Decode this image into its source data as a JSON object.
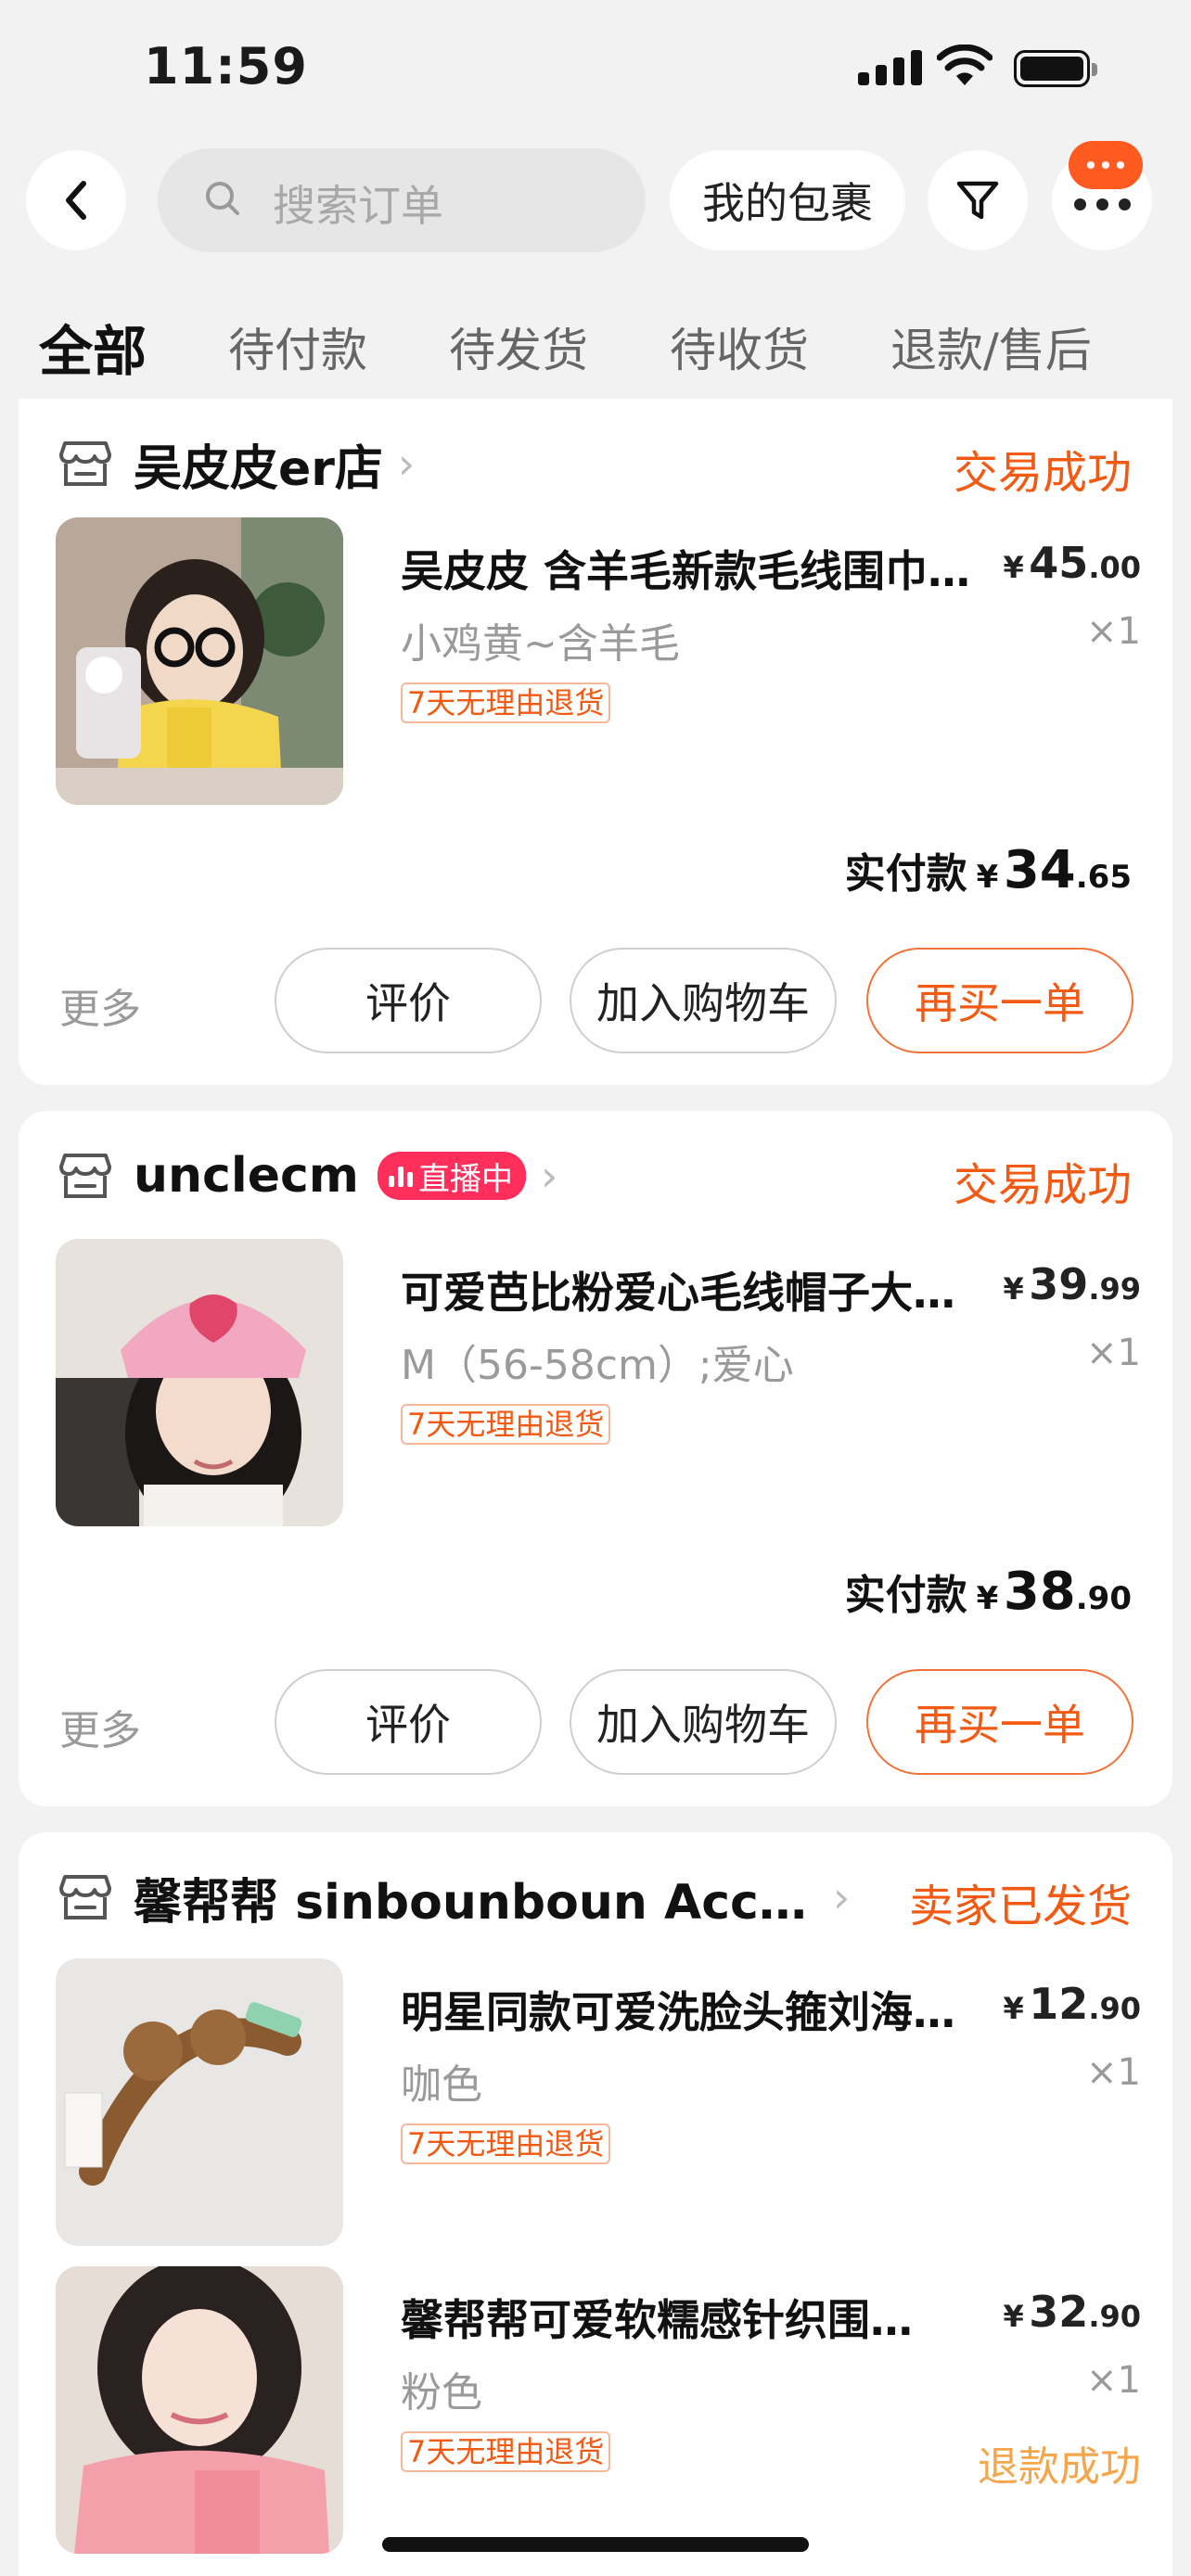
{
  "status_bar": {
    "time": "11:59"
  },
  "header": {
    "search_placeholder": "搜索订单",
    "my_packages": "我的包裹"
  },
  "tabs": [
    "全部",
    "待付款",
    "待发货",
    "待收货",
    "退款/售后"
  ],
  "orders": [
    {
      "shop": "吴皮皮er店",
      "status": "交易成功",
      "items": [
        {
          "title": "吴皮皮 含羊毛新款毛线围巾…",
          "price_symbol": "¥",
          "price_int": "45",
          "price_dec": ".00",
          "sku": "小鸡黄~含羊毛",
          "qty": "×1",
          "tag": "7天无理由退货"
        }
      ],
      "paid_label": "实付款",
      "paid_symbol": "¥",
      "paid_int": "34",
      "paid_dec": ".65",
      "more": "更多",
      "btn_review": "评价",
      "btn_cart": "加入购物车",
      "btn_rebuy": "再买一单"
    },
    {
      "shop": "unclecm",
      "live_badge": "直播中",
      "status": "交易成功",
      "items": [
        {
          "title": "可爱芭比粉爱心毛线帽子大…",
          "price_symbol": "¥",
          "price_int": "39",
          "price_dec": ".99",
          "sku": "M（56-58cm）;爱心",
          "qty": "×1",
          "tag": "7天无理由退货"
        }
      ],
      "paid_label": "实付款",
      "paid_symbol": "¥",
      "paid_int": "38",
      "paid_dec": ".90",
      "more": "更多",
      "btn_review": "评价",
      "btn_cart": "加入购物车",
      "btn_rebuy": "再买一单"
    },
    {
      "shop": "馨帮帮 sinbounboun Acc…",
      "status": "卖家已发货",
      "items": [
        {
          "title": "明星同款可爱洗脸头箍刘海…",
          "price_symbol": "¥",
          "price_int": "12",
          "price_dec": ".90",
          "sku": "咖色",
          "qty": "×1",
          "tag": "7天无理由退货"
        },
        {
          "title": "馨帮帮可爱软糯感针织围…",
          "price_symbol": "¥",
          "price_int": "32",
          "price_dec": ".90",
          "sku": "粉色",
          "qty": "×1",
          "tag": "7天无理由退货",
          "refund_status": "退款成功"
        }
      ]
    }
  ],
  "colors": {
    "accent": "#f25a13",
    "live": "#ff2e5b",
    "refund": "#f5a54a"
  }
}
